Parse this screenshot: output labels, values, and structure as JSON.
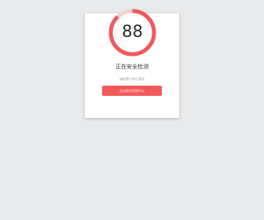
{
  "security_check": {
    "score": "88",
    "progress": 0.88,
    "status_text": "正在安全检测",
    "hint_text": "请稍等片刻后再试",
    "action_label": "点击前往帮助中心"
  },
  "colors": {
    "background": "#e9eaec",
    "card": "#ffffff",
    "accent": "#f05a5a",
    "ring_track": "#f3d0d0"
  }
}
